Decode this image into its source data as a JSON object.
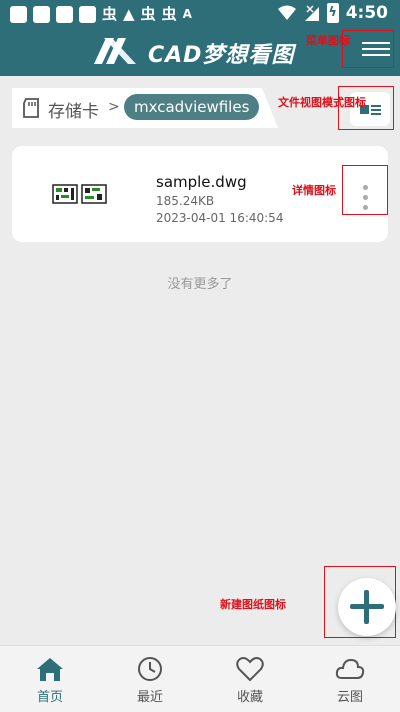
{
  "status_bar": {
    "glyphs": [
      "虫",
      "▲",
      "虫",
      "虫",
      "A"
    ],
    "battery_glyph": "ϟ",
    "time": "4:50"
  },
  "header": {
    "title": "CAD梦想看图",
    "menu_icon": "menu-icon"
  },
  "breadcrumb": {
    "root_label": "存储卡",
    "separator": ">",
    "current": "mxcadviewfiles"
  },
  "files": [
    {
      "name": "sample.dwg",
      "size": "185.24KB",
      "modified": "2023-04-01 16:40:54"
    }
  ],
  "list_footer": "没有更多了",
  "annotations": {
    "menu": "菜单图标",
    "view_mode": "文件视图模式图标",
    "details": "详情图标",
    "new_drawing": "新建图纸图标"
  },
  "bottom_nav": [
    {
      "label": "首页",
      "icon": "home-icon",
      "active": true
    },
    {
      "label": "最近",
      "icon": "clock-icon",
      "active": false
    },
    {
      "label": "收藏",
      "icon": "heart-icon",
      "active": false
    },
    {
      "label": "云图",
      "icon": "cloud-icon",
      "active": false
    }
  ],
  "colors": {
    "primary": "#2e6e78",
    "annotation": "#e0101a",
    "background": "#ececec"
  }
}
